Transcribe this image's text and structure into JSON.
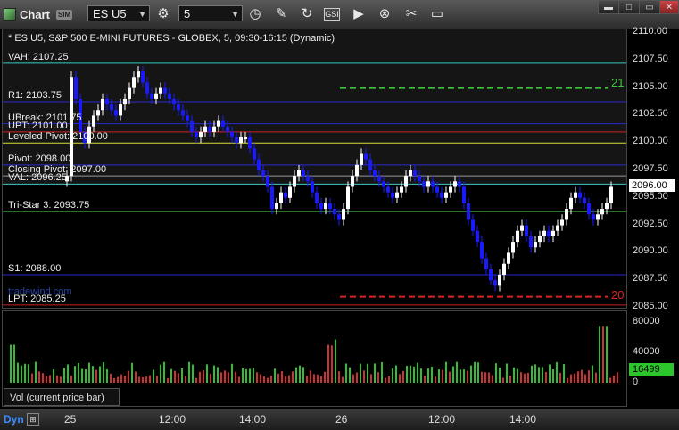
{
  "toolbar": {
    "app_title": "Chart",
    "app_badge": "SIM",
    "symbol": "ES U5",
    "interval": "5",
    "icons": [
      "settings-icon",
      "clock-icon",
      "pencil-icon",
      "refresh-icon",
      "gsi-icon",
      "play-icon",
      "zoom-icon",
      "tool-icon",
      "note-icon"
    ]
  },
  "chart": {
    "header": "* ES U5, S&P 500 E-MINI FUTURES - GLOBEX, 5, 09:30-16:15 (Dynamic)",
    "price_ticks": [
      "2110.00",
      "2107.50",
      "2105.00",
      "2102.50",
      "2100.00",
      "2097.50",
      "2095.00",
      "2092.50",
      "2090.00",
      "2087.50",
      "2085.00"
    ],
    "current_price": "2096.00",
    "levels": [
      {
        "label": "VAH: 2107.25",
        "price": 2107.25,
        "color": "#3fc8c8"
      },
      {
        "label": "R1: 2103.75",
        "price": 2103.75,
        "color": "#2a2acc"
      },
      {
        "label": "UBreak: 2101.75",
        "price": 2101.75,
        "color": "#2a2acc"
      },
      {
        "label": "UPT: 2101.00",
        "price": 2101.0,
        "color": "#cc2222"
      },
      {
        "label": "Leveled Pivot: 2100.00",
        "price": 2100.0,
        "color": "#dddd33"
      },
      {
        "label": "Pivot: 2098.00",
        "price": 2098.0,
        "color": "#2a2acc"
      },
      {
        "label": "Closing Pivot: 2097.00",
        "price": 2097.0,
        "color": "#999999"
      },
      {
        "label": "VAL: 2096.25",
        "price": 2096.25,
        "color": "#3fc8c8"
      },
      {
        "label": "Tri-Star 3: 2093.75",
        "price": 2093.75,
        "color": "#2f9a2f"
      },
      {
        "label": "S1: 2088.00",
        "price": 2088.0,
        "color": "#2a2acc"
      },
      {
        "label": "LPT: 2085.25",
        "price": 2085.25,
        "color": "#cc2222"
      }
    ],
    "marker_21": "21",
    "marker_20": "20",
    "watermark": "tradewind.com",
    "vol_ticks": [
      "80000",
      "40000",
      "0"
    ],
    "vol_current": "16499",
    "vol_label": "Vol (current price bar)",
    "time_labels": [
      "25",
      "12:00",
      "14:00",
      "26",
      "12:00",
      "14:00"
    ],
    "dyn_label": "Dyn",
    "colors": {
      "up": "#ffffff",
      "down": "#1a1aff",
      "bg": "#000000"
    }
  }
}
